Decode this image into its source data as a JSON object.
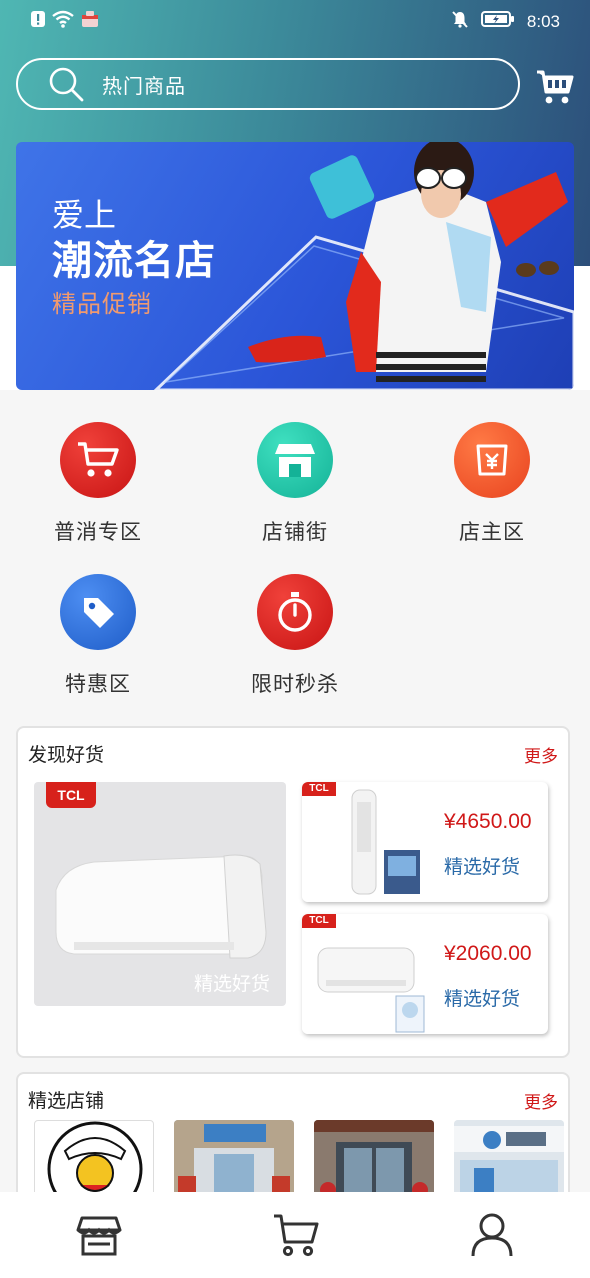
{
  "status_bar": {
    "time": "8:03"
  },
  "search": {
    "placeholder": "热门商品"
  },
  "banner": {
    "line1": "爱上",
    "line2": "潮流名店",
    "line3": "精品促销"
  },
  "categories": [
    {
      "label": "普消专区",
      "icon": "cart-icon",
      "color": "#d81f1f"
    },
    {
      "label": "店铺街",
      "icon": "storefront-icon",
      "color": "#23c2a6"
    },
    {
      "label": "店主区",
      "icon": "yen-bag-icon",
      "color": "#f0532a"
    },
    {
      "label": "特惠区",
      "icon": "tag-icon",
      "color": "#2c73d9"
    },
    {
      "label": "限时秒杀",
      "icon": "stopwatch-icon",
      "color": "#d81f1f"
    }
  ],
  "discover": {
    "title": "发现好货",
    "more": "更多",
    "main_item": {
      "brand": "TCL",
      "label": "精选好货"
    },
    "items": [
      {
        "brand": "TCL",
        "price": "¥4650.00",
        "label": "精选好货"
      },
      {
        "brand": "TCL",
        "price": "¥2060.00",
        "label": "精选好货"
      }
    ]
  },
  "shops": {
    "title": "精选店铺",
    "more": "更多",
    "items": [
      {
        "name": "shop-1"
      },
      {
        "name": "shop-2"
      },
      {
        "name": "shop-3"
      },
      {
        "name": "shop-4"
      }
    ]
  },
  "bottom_nav": [
    {
      "icon": "store-icon"
    },
    {
      "icon": "cart-icon"
    },
    {
      "icon": "user-icon"
    }
  ]
}
